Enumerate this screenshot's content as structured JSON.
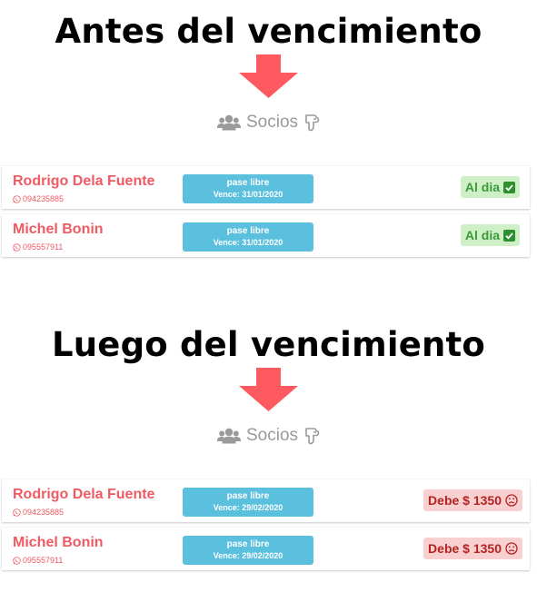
{
  "sections": [
    {
      "heading": "Antes del vencimiento",
      "list_header": "Socios",
      "members": [
        {
          "name": "Rodrigo Dela Fuente",
          "phone": "094235885",
          "plan": "pase libre",
          "expiry": "Vence: 31/01/2020",
          "status": "Al dia"
        },
        {
          "name": "Michel Bonin",
          "phone": "095557911",
          "plan": "pase libre",
          "expiry": "Vence: 31/01/2020",
          "status": "Al dia"
        }
      ]
    },
    {
      "heading": "Luego del vencimiento",
      "list_header": "Socios",
      "members": [
        {
          "name": "Rodrigo Dela Fuente",
          "phone": "094235885",
          "plan": "pase libre",
          "expiry": "Vence: 29/02/2020",
          "status": "Debe $ 1350"
        },
        {
          "name": "Michel Bonin",
          "phone": "095557911",
          "plan": "pase libre",
          "expiry": "Vence: 29/02/2020",
          "status": "Debe $ 1350"
        }
      ]
    }
  ],
  "icons": {
    "arrow": "down-arrow-icon",
    "users": "users-icon",
    "sort": "sort-hand-icon",
    "phone": "whatsapp-icon",
    "ok": "check-square-icon",
    "debt": "frown-icon"
  },
  "colors": {
    "arrow": "#ff5a5f",
    "name": "#ef5a63",
    "plan_badge": "#5bc0de",
    "ok_bg": "#cff0c7",
    "ok_text": "#3a9a3a",
    "debt_bg": "#f8d0d0",
    "debt_text": "#b52222",
    "muted": "#9a9a9a"
  }
}
